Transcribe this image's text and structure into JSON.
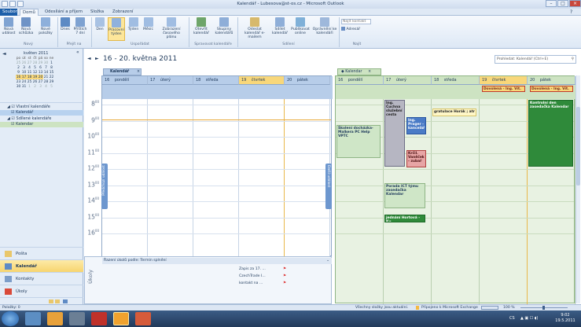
{
  "window": {
    "title": "Kalendář - Lubesova@st-os.cz - Microsoft Outlook"
  },
  "tabs": [
    "Soubor",
    "Domů",
    "Odesílání a příjem",
    "Složka",
    "Zobrazení"
  ],
  "ribbon": {
    "buttons": [
      "Nová událost",
      "Nová schůzka",
      "Nové položky",
      "Dnes",
      "Příštích 7 dní",
      "Den",
      "Pracovní týden",
      "Týden",
      "Měsíc",
      "Zobrazení časového plánu",
      "Otevřít kalendář",
      "Skupiny kalendářů",
      "Odeslat kalendář e-mailem",
      "Sdílet kalendář",
      "Publikovat online",
      "Oprávnění ke kalendáři"
    ],
    "groups": [
      "Nový",
      "Přejít na",
      "Uspořádat",
      "Spravovat kalendáře",
      "Sdílení",
      "Najít"
    ],
    "find_contact": "Najít kontakt",
    "address_book": "Adresář"
  },
  "nav": {
    "month_title": "květen 2011",
    "weekdays": [
      "po",
      "út",
      "st",
      "čt",
      "pá",
      "so",
      "ne"
    ],
    "weeks": [
      [
        "25",
        "26",
        "27",
        "28",
        "29",
        "30",
        "1"
      ],
      [
        "2",
        "3",
        "4",
        "5",
        "6",
        "7",
        "8"
      ],
      [
        "9",
        "10",
        "11",
        "12",
        "13",
        "14",
        "15"
      ],
      [
        "16",
        "17",
        "18",
        "19",
        "20",
        "21",
        "22"
      ],
      [
        "23",
        "24",
        "25",
        "26",
        "27",
        "28",
        "29"
      ],
      [
        "30",
        "31",
        "1",
        "2",
        "3",
        "4",
        "5"
      ]
    ],
    "sections": [
      {
        "title": "Vlastní kalendáře",
        "items": [
          "Kalendář"
        ]
      },
      {
        "title": "Sdílené kalendáře",
        "items": [
          "Kalendar"
        ]
      }
    ],
    "buttons": [
      "Pošta",
      "Kalendář",
      "Kontakty",
      "Úkoly"
    ]
  },
  "main": {
    "range": "16 - 20. května 2011",
    "search_placeholder": "Prohledat: Kalendář (Ctrl+E)",
    "left_tab": "Kalendář",
    "right_tab": "Kalendar",
    "days": [
      {
        "n": "16",
        "name": "pondělí"
      },
      {
        "n": "17",
        "name": "úterý"
      },
      {
        "n": "18",
        "name": "středa"
      },
      {
        "n": "19",
        "name": "čtvrtek"
      },
      {
        "n": "20",
        "name": "pátek"
      }
    ],
    "hours": [
      "8",
      "9",
      "10",
      "11",
      "12",
      "13",
      "14",
      "15",
      "16"
    ],
    "minutes": "00",
    "prev_label": "Předchozí událost",
    "next_label": "Další událost",
    "tasks_header": "Řazení úkolů podle: Termín splnění",
    "tasks_label": "Úkoly",
    "tasks": [
      "Zapis za 17. ...",
      "CzechTrade I...",
      "kontakt na ..."
    ],
    "allday": [
      {
        "day": 3,
        "text": "Dovolená - Ing. Vít."
      },
      {
        "day": 4,
        "text": "Dovolená - Ing. Vít."
      }
    ],
    "appointments": [
      {
        "text": "Ing. Čuchna služební cesta"
      },
      {
        "text": "Školení docházka-Malkera PC Help VPTC"
      },
      {
        "text": "gratulace Horák ; atr"
      },
      {
        "text": "Ing. Prager - kancelář"
      },
      {
        "text": "Kontrolní den zasedačka Kalendar"
      },
      {
        "text": "Krčil. Vaněček - zubař"
      },
      {
        "text": "Porada ICT týmu zasedačka Kalendar"
      },
      {
        "text": "jednání Hortová - Ku"
      }
    ]
  },
  "status": {
    "left": "Položky: 0",
    "sync": "Všechny složky jsou aktuální.",
    "conn": "Připojeno k Microsoft Exchange",
    "zoom": "100 %"
  },
  "taskbar": {
    "lang": "CS",
    "time": "9:02",
    "date": "19.5.2011"
  },
  "colors": {
    "accent": "#1d5fa9",
    "today": "#f8d77a",
    "shared": "#cde3c2",
    "calblue": "#b7cde9"
  }
}
